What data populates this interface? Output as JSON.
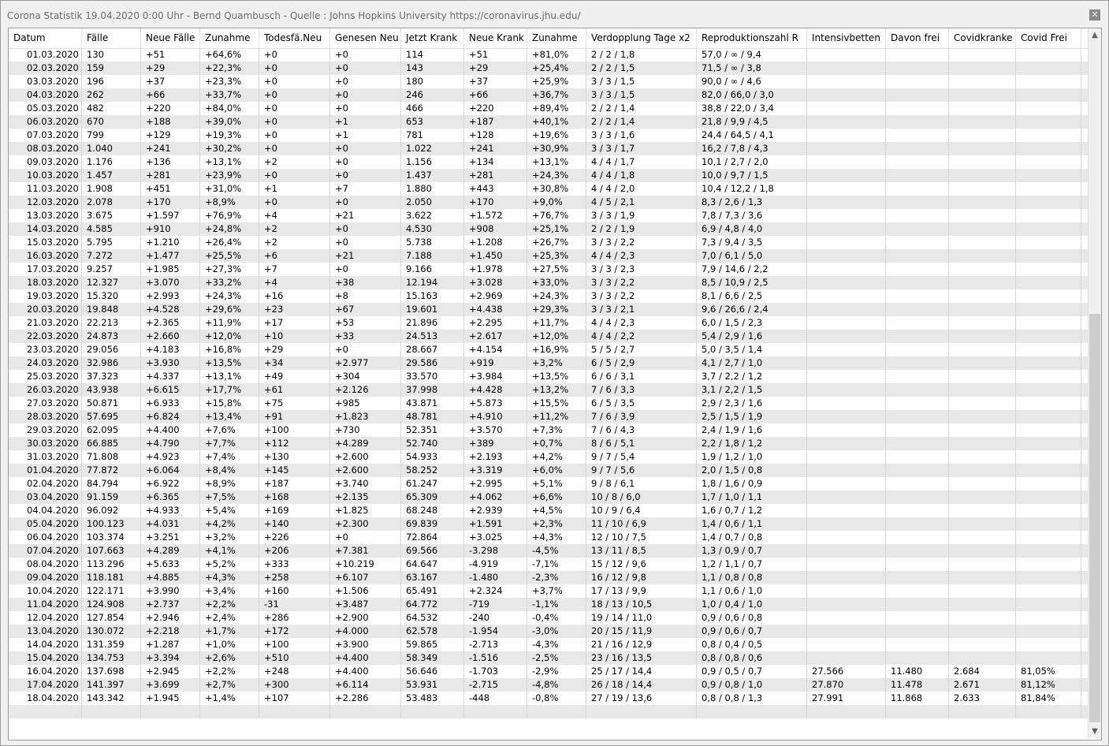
{
  "window": {
    "title": "Corona Statistik 19.04.2020 0:00 Uhr - Bernd Quambusch - Quelle : Johns Hopkins University https://coronavirus.jhu.edu/",
    "close_label": "✕"
  },
  "table": {
    "columns": [
      "Datum",
      "Fälle",
      "Neue Fälle",
      "Zunahme",
      "Todesfä.Neu",
      "Genesen Neu",
      "Jetzt Krank",
      "Neue Krank",
      "Zunahme",
      "Verdopplung Tage x2",
      "Reproduktionszahl R",
      "Intensivbetten",
      "Davon frei",
      "Covidkranke",
      "Covid Frei"
    ],
    "rows": [
      [
        "01.03.2020",
        "130",
        "+51",
        "+64,6%",
        "+0",
        "+0",
        "114",
        "+51",
        "+81,0%",
        "2  /  2  /  1,8",
        "57,0  /  ∞  /  9,4",
        "",
        "",
        "",
        ""
      ],
      [
        "02.03.2020",
        "159",
        "+29",
        "+22,3%",
        "+0",
        "+0",
        "143",
        "+29",
        "+25,4%",
        "2  /  2  /  1,5",
        "71,5  /  ∞  /  3,8",
        "",
        "",
        "",
        ""
      ],
      [
        "03.03.2020",
        "196",
        "+37",
        "+23,3%",
        "+0",
        "+0",
        "180",
        "+37",
        "+25,9%",
        "3  /  3  /  1,5",
        "90,0  /  ∞  /  4,6",
        "",
        "",
        "",
        ""
      ],
      [
        "04.03.2020",
        "262",
        "+66",
        "+33,7%",
        "+0",
        "+0",
        "246",
        "+66",
        "+36,7%",
        "3  /  3  /  1,5",
        "82,0  /  66,0  /  3,0",
        "",
        "",
        "",
        ""
      ],
      [
        "05.03.2020",
        "482",
        "+220",
        "+84,0%",
        "+0",
        "+0",
        "466",
        "+220",
        "+89,4%",
        "2  /  2  /  1,4",
        "38,8  /  22,0  /  3,4",
        "",
        "",
        "",
        ""
      ],
      [
        "06.03.2020",
        "670",
        "+188",
        "+39,0%",
        "+0",
        "+1",
        "653",
        "+187",
        "+40,1%",
        "2  /  2  /  1,4",
        "21,8  /  9,9  /  4,5",
        "",
        "",
        "",
        ""
      ],
      [
        "07.03.2020",
        "799",
        "+129",
        "+19,3%",
        "+0",
        "+1",
        "781",
        "+128",
        "+19,6%",
        "3  /  3  /  1,6",
        "24,4  /  64,5  /  4,1",
        "",
        "",
        "",
        ""
      ],
      [
        "08.03.2020",
        "1.040",
        "+241",
        "+30,2%",
        "+0",
        "+0",
        "1.022",
        "+241",
        "+30,9%",
        "3  /  3  /  1,7",
        "16,2  /  7,8  /  4,3",
        "",
        "",
        "",
        ""
      ],
      [
        "09.03.2020",
        "1.176",
        "+136",
        "+13,1%",
        "+2",
        "+0",
        "1.156",
        "+134",
        "+13,1%",
        "4  /  4  /  1,7",
        "10,1  /  2,7  /  2,0",
        "",
        "",
        "",
        ""
      ],
      [
        "10.03.2020",
        "1.457",
        "+281",
        "+23,9%",
        "+0",
        "+0",
        "1.437",
        "+281",
        "+24,3%",
        "4  /  4  /  1,8",
        "10,0  /  9,7  /  1,5",
        "",
        "",
        "",
        ""
      ],
      [
        "11.03.2020",
        "1.908",
        "+451",
        "+31,0%",
        "+1",
        "+7",
        "1.880",
        "+443",
        "+30,8%",
        "4  /  4  /  2,0",
        "10,4  /  12,2  /  1,8",
        "",
        "",
        "",
        ""
      ],
      [
        "12.03.2020",
        "2.078",
        "+170",
        "+8,9%",
        "+0",
        "+0",
        "2.050",
        "+170",
        "+9,0%",
        "4  /  5  /  2,1",
        "8,3  /  2,6  /  1,3",
        "",
        "",
        "",
        ""
      ],
      [
        "13.03.2020",
        "3.675",
        "+1.597",
        "+76,9%",
        "+4",
        "+21",
        "3.622",
        "+1.572",
        "+76,7%",
        "3  /  3  /  1,9",
        "7,8  /  7,3  /  3,6",
        "",
        "",
        "",
        ""
      ],
      [
        "14.03.2020",
        "4.585",
        "+910",
        "+24,8%",
        "+2",
        "+0",
        "4.530",
        "+908",
        "+25,1%",
        "2  /  2  /  1,9",
        "6,9  /  4,8  /  4,0",
        "",
        "",
        "",
        ""
      ],
      [
        "15.03.2020",
        "5.795",
        "+1.210",
        "+26,4%",
        "+2",
        "+0",
        "5.738",
        "+1.208",
        "+26,7%",
        "3  /  3  /  2,2",
        "7,3  /  9,4  /  3,5",
        "",
        "",
        "",
        ""
      ],
      [
        "16.03.2020",
        "7.272",
        "+1.477",
        "+25,5%",
        "+6",
        "+21",
        "7.188",
        "+1.450",
        "+25,3%",
        "4  /  4  /  2,3",
        "7,0  /  6,1  /  5,0",
        "",
        "",
        "",
        ""
      ],
      [
        "17.03.2020",
        "9.257",
        "+1.985",
        "+27,3%",
        "+7",
        "+0",
        "9.166",
        "+1.978",
        "+27,5%",
        "3  /  3  /  2,3",
        "7,9  /  14,6  /  2,2",
        "",
        "",
        "",
        ""
      ],
      [
        "18.03.2020",
        "12.327",
        "+3.070",
        "+33,2%",
        "+4",
        "+38",
        "12.194",
        "+3.028",
        "+33,0%",
        "3  /  3  /  2,2",
        "8,5  /  10,9  /  2,5",
        "",
        "",
        "",
        ""
      ],
      [
        "19.03.2020",
        "15.320",
        "+2.993",
        "+24,3%",
        "+16",
        "+8",
        "15.163",
        "+2.969",
        "+24,3%",
        "3  /  3  /  2,2",
        "8,1  /  6,6  /  2,5",
        "",
        "",
        "",
        ""
      ],
      [
        "20.03.2020",
        "19.848",
        "+4.528",
        "+29,6%",
        "+23",
        "+67",
        "19.601",
        "+4.438",
        "+29,3%",
        "3  /  3  /  2,1",
        "9,6  /  26,6  /  2,4",
        "",
        "",
        "",
        ""
      ],
      [
        "21.03.2020",
        "22.213",
        "+2.365",
        "+11,9%",
        "+17",
        "+53",
        "21.896",
        "+2.295",
        "+11,7%",
        "4  /  4  /  2,3",
        "6,0  /  1,5  /  2,3",
        "",
        "",
        "",
        ""
      ],
      [
        "22.03.2020",
        "24.873",
        "+2.660",
        "+12,0%",
        "+10",
        "+33",
        "24.513",
        "+2.617",
        "+12,0%",
        "4  /  4  /  2,2",
        "5,4  /  2,9  /  1,6",
        "",
        "",
        "",
        ""
      ],
      [
        "23.03.2020",
        "29.056",
        "+4.183",
        "+16,8%",
        "+29",
        "+0",
        "28.667",
        "+4.154",
        "+16,9%",
        "5  /  5  /  2,7",
        "5,0  /  3,5  /  1,4",
        "",
        "",
        "",
        ""
      ],
      [
        "24.03.2020",
        "32.986",
        "+3.930",
        "+13,5%",
        "+34",
        "+2.977",
        "29.586",
        "+919",
        "+3,2%",
        "6  /  5  /  2,9",
        "4,1  /  2,7  /  1,0",
        "",
        "",
        "",
        ""
      ],
      [
        "25.03.2020",
        "37.323",
        "+4.337",
        "+13,1%",
        "+49",
        "+304",
        "33.570",
        "+3.984",
        "+13,5%",
        "6  /  6  /  3,1",
        "3,7  /  2,2  /  1,2",
        "",
        "",
        "",
        ""
      ],
      [
        "26.03.2020",
        "43.938",
        "+6.615",
        "+17,7%",
        "+61",
        "+2.126",
        "37.998",
        "+4.428",
        "+13,2%",
        "7  /  6  /  3,3",
        "3,1  /  2,2  /  1,5",
        "",
        "",
        "",
        ""
      ],
      [
        "27.03.2020",
        "50.871",
        "+6.933",
        "+15,8%",
        "+75",
        "+985",
        "43.871",
        "+5.873",
        "+15,5%",
        "6  /  5  /  3,5",
        "2,9  /  2,3  /  1,6",
        "",
        "",
        "",
        ""
      ],
      [
        "28.03.2020",
        "57.695",
        "+6.824",
        "+13,4%",
        "+91",
        "+1.823",
        "48.781",
        "+4.910",
        "+11,2%",
        "7  /  6  /  3,9",
        "2,5  /  1,5  /  1,9",
        "",
        "",
        "",
        ""
      ],
      [
        "29.03.2020",
        "62.095",
        "+4.400",
        "+7,6%",
        "+100",
        "+730",
        "52.351",
        "+3.570",
        "+7,3%",
        "7  /  6  /  4,3",
        "2,4  /  1,9  /  1,6",
        "",
        "",
        "",
        ""
      ],
      [
        "30.03.2020",
        "66.885",
        "+4.790",
        "+7,7%",
        "+112",
        "+4.289",
        "52.740",
        "+389",
        "+0,7%",
        "8  /  6  /  5,1",
        "2,2  /  1,8  /  1,2",
        "",
        "",
        "",
        ""
      ],
      [
        "31.03.2020",
        "71.808",
        "+4.923",
        "+7,4%",
        "+130",
        "+2.600",
        "54.933",
        "+2.193",
        "+4,2%",
        "9  /  7  /  5,4",
        "1,9  /  1,2  /  1,0",
        "",
        "",
        "",
        ""
      ],
      [
        "01.04.2020",
        "77.872",
        "+6.064",
        "+8,4%",
        "+145",
        "+2.600",
        "58.252",
        "+3.319",
        "+6,0%",
        "9  /  7  /  5,6",
        "2,0  /  1,5  /  0,8",
        "",
        "",
        "",
        ""
      ],
      [
        "02.04.2020",
        "84.794",
        "+6.922",
        "+8,9%",
        "+187",
        "+3.740",
        "61.247",
        "+2.995",
        "+5,1%",
        "9  /  8  /  6,1",
        "1,8  /  1,6  /  0,9",
        "",
        "",
        "",
        ""
      ],
      [
        "03.04.2020",
        "91.159",
        "+6.365",
        "+7,5%",
        "+168",
        "+2.135",
        "65.309",
        "+4.062",
        "+6,6%",
        "10  /  8  /  6,0",
        "1,7  /  1,0  /  1,1",
        "",
        "",
        "",
        ""
      ],
      [
        "04.04.2020",
        "96.092",
        "+4.933",
        "+5,4%",
        "+169",
        "+1.825",
        "68.248",
        "+2.939",
        "+4,5%",
        "10  /  9  /  6,4",
        "1,6  /  0,7  /  1,2",
        "",
        "",
        "",
        ""
      ],
      [
        "05.04.2020",
        "100.123",
        "+4.031",
        "+4,2%",
        "+140",
        "+2.300",
        "69.839",
        "+1.591",
        "+2,3%",
        "11  /  10  /  6,9",
        "1,4  /  0,6  /  1,1",
        "",
        "",
        "",
        ""
      ],
      [
        "06.04.2020",
        "103.374",
        "+3.251",
        "+3,2%",
        "+226",
        "+0",
        "72.864",
        "+3.025",
        "+4,3%",
        "12  /  10  /  7,5",
        "1,4  /  0,7  /  0,8",
        "",
        "",
        "",
        ""
      ],
      [
        "07.04.2020",
        "107.663",
        "+4.289",
        "+4,1%",
        "+206",
        "+7.381",
        "69.566",
        "-3.298",
        "-4,5%",
        "13  /  11  /  8,5",
        "1,3  /  0,9  /  0,7",
        "",
        "",
        "",
        ""
      ],
      [
        "08.04.2020",
        "113.296",
        "+5.633",
        "+5,2%",
        "+333",
        "+10.219",
        "64.647",
        "-4.919",
        "-7,1%",
        "15  /  12  /  9,6",
        "1,2  /  1,1  /  0,7",
        "",
        "",
        "",
        ""
      ],
      [
        "09.04.2020",
        "118.181",
        "+4.885",
        "+4,3%",
        "+258",
        "+6.107",
        "63.167",
        "-1.480",
        "-2,3%",
        "16  /  12  /  9,8",
        "1,1  /  0,8  /  0,8",
        "",
        "",
        "",
        ""
      ],
      [
        "10.04.2020",
        "122.171",
        "+3.990",
        "+3,4%",
        "+160",
        "+1.506",
        "65.491",
        "+2.324",
        "+3,7%",
        "17  /  13  /  9,9",
        "1,1  /  0,6  /  1,0",
        "",
        "",
        "",
        ""
      ],
      [
        "11.04.2020",
        "124.908",
        "+2.737",
        "+2,2%",
        "-31",
        "+3.487",
        "64.772",
        "-719",
        "-1,1%",
        "18  /  13  /  10,5",
        "1,0  /  0,4  /  1,0",
        "",
        "",
        "",
        ""
      ],
      [
        "12.04.2020",
        "127.854",
        "+2.946",
        "+2,4%",
        "+286",
        "+2.900",
        "64.532",
        "-240",
        "-0,4%",
        "19  /  14  /  11,0",
        "0,9  /  0,6  /  0,8",
        "",
        "",
        "",
        ""
      ],
      [
        "13.04.2020",
        "130.072",
        "+2.218",
        "+1,7%",
        "+172",
        "+4.000",
        "62.578",
        "-1.954",
        "-3,0%",
        "20  /  15  /  11,9",
        "0,9  /  0,6  /  0,7",
        "",
        "",
        "",
        ""
      ],
      [
        "14.04.2020",
        "131.359",
        "+1.287",
        "+1,0%",
        "+100",
        "+3.900",
        "59.865",
        "-2.713",
        "-4,3%",
        "21  /  16  /  12,9",
        "0,8  /  0,4  /  0,5",
        "",
        "",
        "",
        ""
      ],
      [
        "15.04.2020",
        "134.753",
        "+3.394",
        "+2,6%",
        "+510",
        "+4.400",
        "58.349",
        "-1.516",
        "-2,5%",
        "23  /  16  /  13,5",
        "0,8  /  0,8  /  0,6",
        "",
        "",
        "",
        ""
      ],
      [
        "16.04.2020",
        "137.698",
        "+2.945",
        "+2,2%",
        "+248",
        "+4.400",
        "56.646",
        "-1.703",
        "-2,9%",
        "25  /  17  /  14,4",
        "0,9  /  0,5  /  0,7",
        "27.566",
        "11.480",
        "2.684",
        "81,05%"
      ],
      [
        "17.04.2020",
        "141.397",
        "+3.699",
        "+2,7%",
        "+300",
        "+6.114",
        "53.931",
        "-2.715",
        "-4,8%",
        "26  /  18  /  14,4",
        "0,9  /  0,8  /  1,0",
        "27.870",
        "11.478",
        "2.671",
        "81,12%"
      ],
      [
        "18.04.2020",
        "143.342",
        "+1.945",
        "+1,4%",
        "+107",
        "+2.286",
        "53.483",
        "-448",
        "-0,8%",
        "27  /  19  /  13,6",
        "0,8  /  0,8  /  1,3",
        "27.991",
        "11.868",
        "2.633",
        "81,84%"
      ],
      [
        "",
        "",
        "",
        "",
        "",
        "",
        "",
        "",
        "",
        "",
        "",
        "",
        "",
        "",
        ""
      ]
    ]
  },
  "scrollbar": {
    "up_label": "▲",
    "down_label": "▼"
  },
  "colors": {
    "row_alt": "#e8e8e8",
    "grid_line": "#d6d6d6",
    "title_text": "#6d6d6d"
  }
}
